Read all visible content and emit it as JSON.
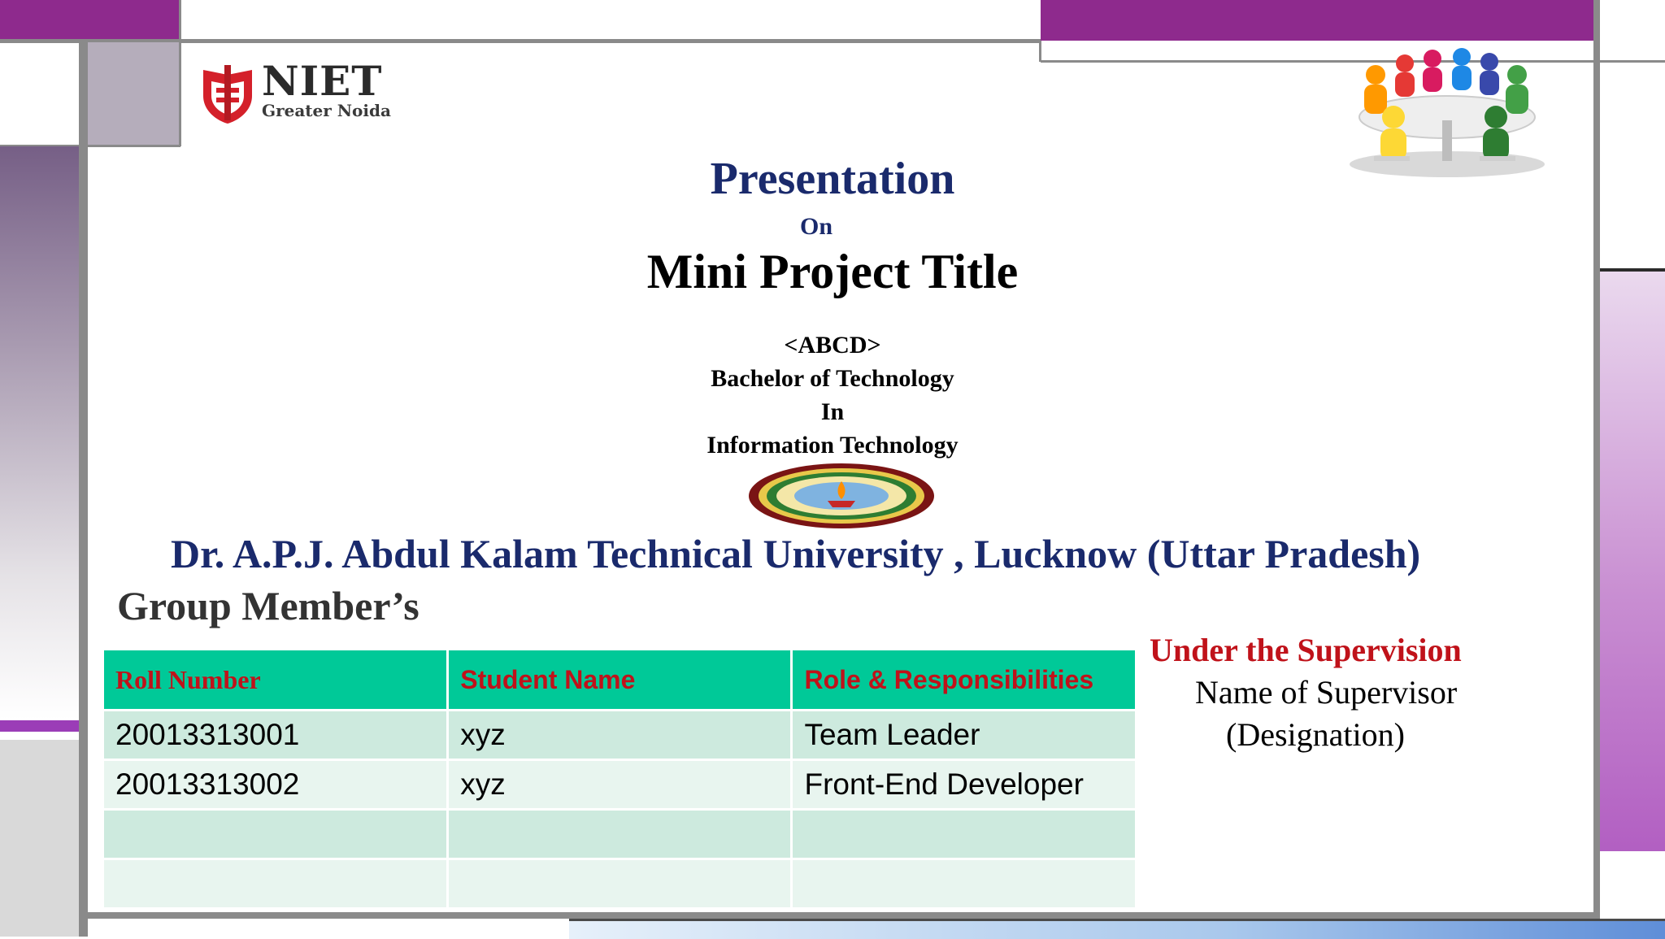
{
  "logo": {
    "main": "NIET",
    "sub": "Greater Noida"
  },
  "titles": {
    "presentation": "Presentation",
    "on": "On",
    "project_title": "Mini Project Title",
    "abcd": "<ABCD>",
    "degree": "Bachelor of Technology",
    "in": "In",
    "branch": "Information Technology"
  },
  "university": "Dr. A.P.J. Abdul Kalam Technical University , Lucknow (Uttar Pradesh)",
  "group_heading": "Group Member’s",
  "table": {
    "headers": [
      "Roll Number",
      "Student Name",
      "Role & Responsibilities"
    ],
    "rows": [
      [
        "20013313001",
        "xyz",
        "Team Leader"
      ],
      [
        "20013313002",
        "xyz",
        "Front-End Developer"
      ],
      [
        "",
        "",
        ""
      ],
      [
        "",
        "",
        ""
      ]
    ]
  },
  "supervision": {
    "heading": "Under the Supervision",
    "name": "Name of Supervisor",
    "designation": "(Designation)"
  },
  "colors": {
    "accent_purple": "#8e2a8d",
    "title_navy": "#1a2a6c",
    "header_red": "#c0121a",
    "table_header_green": "#00c998"
  }
}
